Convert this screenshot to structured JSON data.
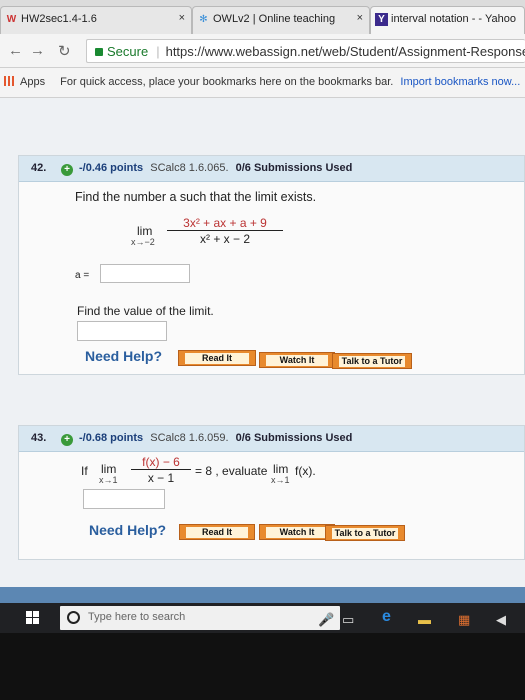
{
  "browser": {
    "tabs": [
      {
        "title": "HW2sec1.4-1.6",
        "close": "×"
      },
      {
        "title": "OWLv2 | Online teaching",
        "close": "×"
      },
      {
        "title": "interval notation - - Yahoo",
        "close": ""
      }
    ],
    "secure_label": "Secure",
    "url": "https://www.webassign.net/web/Student/Assignment-Responses",
    "bookmarks_apps": "Apps",
    "bookmarks_hint": "For quick access, place your bookmarks here on the bookmarks bar.",
    "bookmarks_import": "Import bookmarks now..."
  },
  "q42": {
    "number": "42.",
    "points": "-/0.46 points",
    "source": "SCalc8 1.6.065.",
    "submissions": "0/6 Submissions Used",
    "prompt": "Find the number a such that the limit exists.",
    "lim": "lim",
    "lim_sub": "x→−2",
    "numerator": "3x² + ax + a + 9",
    "denominator": "x² + x − 2",
    "a_label": "a =",
    "a_value": "",
    "prompt2": "Find the value of the limit.",
    "limit_value": "",
    "need_help": "Need Help?",
    "read_it": "Read It",
    "watch_it": "Watch It",
    "talk_tutor": "Talk to a Tutor"
  },
  "q43": {
    "number": "43.",
    "points": "-/0.68 points",
    "source": "SCalc8 1.6.059.",
    "submissions": "0/6 Submissions Used",
    "if_label": "If",
    "lim": "lim",
    "lim_sub": "x→1",
    "numerator": "f(x) − 6",
    "denominator": "x − 1",
    "equals": "= 8 , evaluate",
    "lim2": "lim",
    "lim2_sub": "x→1",
    "fx": "f(x).",
    "answer_value": "",
    "need_help": "Need Help?",
    "read_it": "Read It",
    "watch_it": "Watch It",
    "talk_tutor": "Talk to a Tutor"
  },
  "taskbar": {
    "search_placeholder": "Type here to search"
  }
}
